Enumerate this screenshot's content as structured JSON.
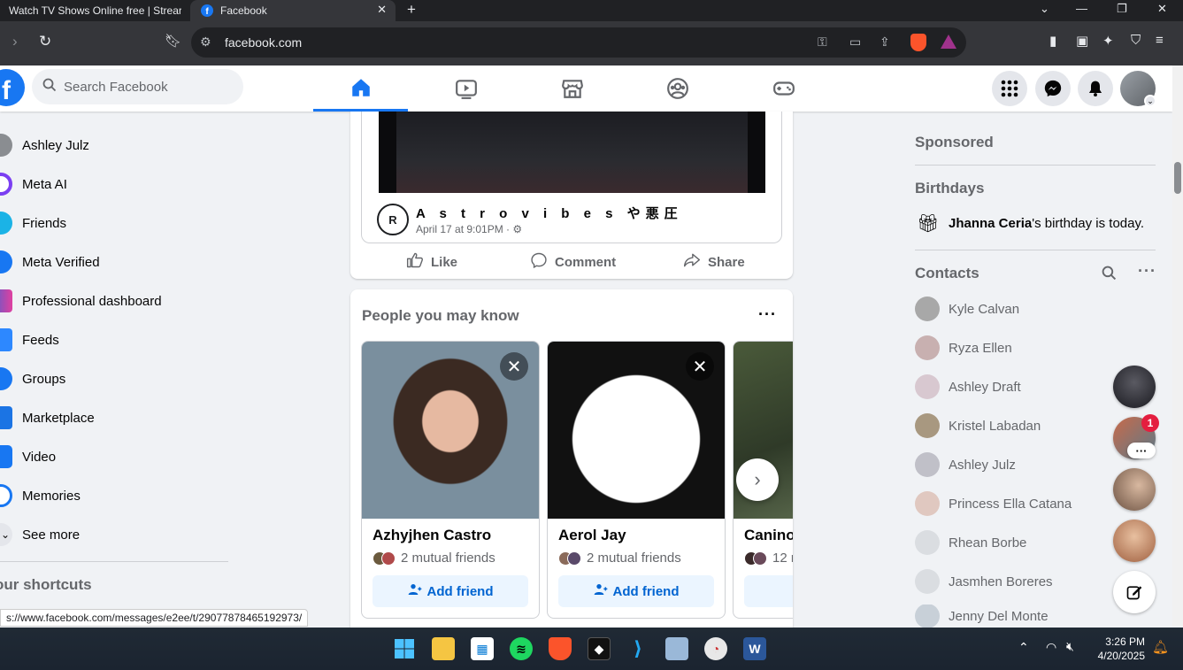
{
  "browser": {
    "tabs": [
      {
        "title": "Watch TV Shows Online free | Strear"
      },
      {
        "title": "Facebook"
      }
    ],
    "url": "facebook.com",
    "status_url": "s://www.facebook.com/messages/e2ee/t/29077878465192973/"
  },
  "header": {
    "logo": "f",
    "search_placeholder": "Search Facebook"
  },
  "sidebar": {
    "items": [
      {
        "label": "Ashley Julz",
        "color": "#8a8d91"
      },
      {
        "label": "Meta AI",
        "color": "#7b3ff2"
      },
      {
        "label": "Friends",
        "color": "#1bb3e6"
      },
      {
        "label": "Meta Verified",
        "color": "#1877f2"
      },
      {
        "label": "Professional dashboard",
        "color": "#4a5fd1"
      },
      {
        "label": "Feeds",
        "color": "#2d88ff"
      },
      {
        "label": "Groups",
        "color": "#1877f2"
      },
      {
        "label": "Marketplace",
        "color": "#1b74e4"
      },
      {
        "label": "Video",
        "color": "#1877f2"
      },
      {
        "label": "Memories",
        "color": "#1877f2"
      },
      {
        "label": "See more",
        "color": "#050505"
      }
    ],
    "shortcuts_heading": "our shortcuts"
  },
  "post": {
    "page_name": "A s t r o v i b e s や悪圧",
    "avatar_text": "R",
    "meta": "April 17 at 9:01PM ·",
    "actions": {
      "like": "Like",
      "comment": "Comment",
      "share": "Share"
    }
  },
  "pymk": {
    "title": "People you may know",
    "people": [
      {
        "name": "Azhyjhen Castro",
        "mutual": "2 mutual friends",
        "add": "Add friend"
      },
      {
        "name": "Aerol Jay",
        "mutual": "2 mutual friends",
        "add": "Add friend"
      },
      {
        "name": "Canino",
        "mutual": "12 m",
        "add": ""
      }
    ]
  },
  "right": {
    "sponsored": "Sponsored",
    "birthdays": "Birthdays",
    "birthday_name": "Jhanna Ceria",
    "birthday_text": "'s birthday is today.",
    "contacts_heading": "Contacts",
    "contacts": [
      "Kyle Calvan",
      "Ryza Ellen",
      "Ashley Draft",
      "Kristel Labadan",
      "Ashley Julz",
      "Princess Ella Catana",
      "Rhean Borbe",
      "Jasmhen Boreres",
      "Jenny Del Monte"
    ],
    "chat_badge": "1"
  },
  "taskbar": {
    "time": "3:26 PM",
    "date": "4/20/2025"
  },
  "colors": {
    "brand": "#1877f2",
    "add_friend_bg": "#ebf5ff",
    "add_friend_text": "#0064d1",
    "badge": "#e41e3f"
  }
}
